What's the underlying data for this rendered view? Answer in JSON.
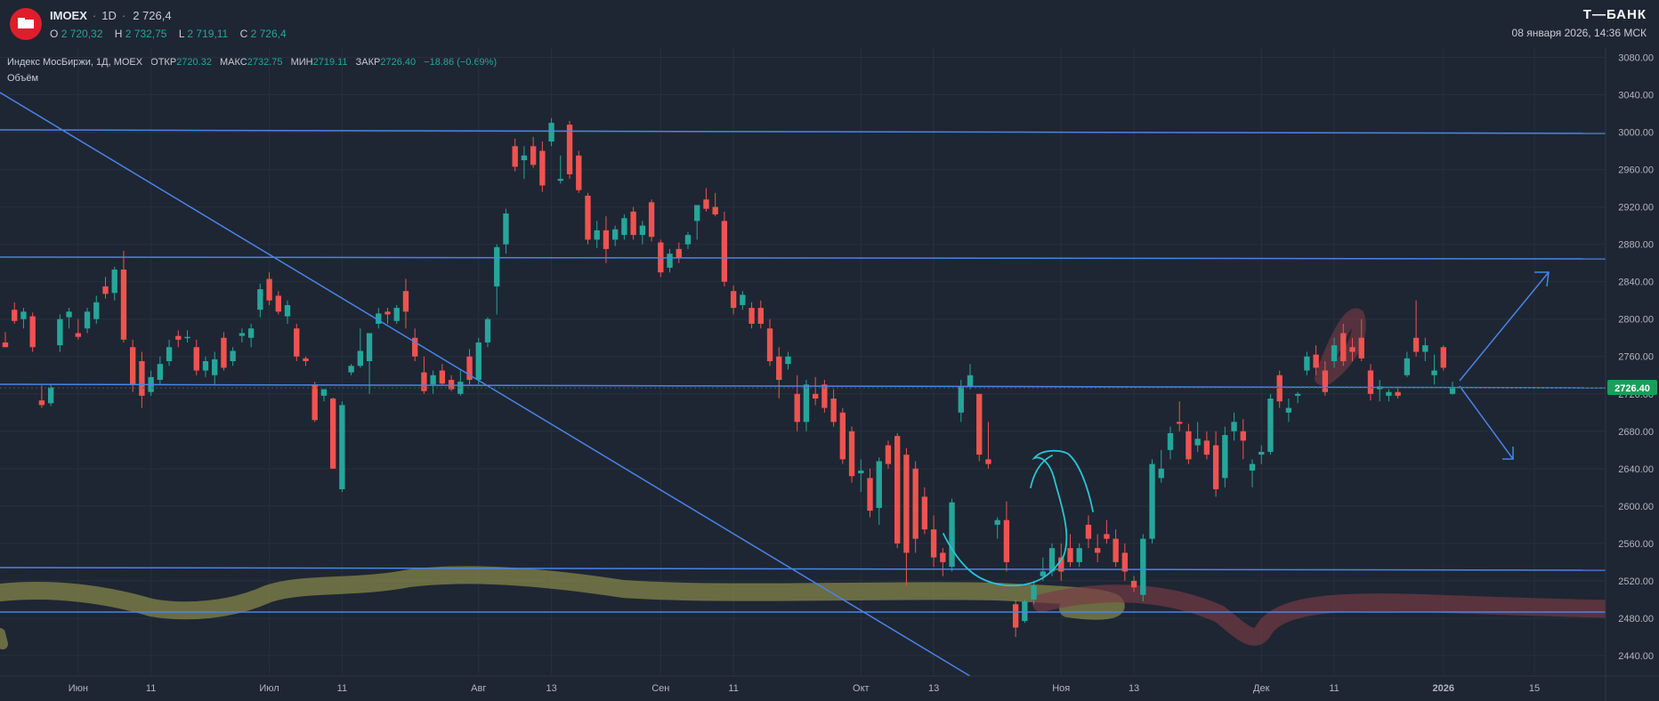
{
  "header": {
    "symbol": "IMOEX",
    "timeframe": "1D",
    "price": "2 726,4",
    "ohlc": [
      {
        "label": "O",
        "value": "2 720,32"
      },
      {
        "label": "H",
        "value": "2 732,75"
      },
      {
        "label": "L",
        "value": "2 719,11"
      },
      {
        "label": "C",
        "value": "2 726,4"
      }
    ],
    "brand": "Т—БАНК",
    "datetime": "08 января 2026, 14:36 МСК"
  },
  "legend": {
    "name": "Индекс МосБиржи, 1Д, MOEX",
    "items": [
      {
        "label": "ОТКР",
        "value": "2720.32"
      },
      {
        "label": "МАКС",
        "value": "2732.75"
      },
      {
        "label": "МИН",
        "value": "2719.11"
      },
      {
        "label": "ЗАКР",
        "value": "2726.40"
      }
    ],
    "change": "−18.86 (−0.69%)",
    "volume_label": "Объём"
  },
  "colors": {
    "background": "#1e2633",
    "up": "#26a69a",
    "down": "#ef5350",
    "drawing_line": "#4a84e8",
    "marker_yellow": "#8a8a4a",
    "marker_red": "#7a3a45",
    "pen_cyan": "#2bc4d4",
    "price_badge": "#1a9e5a"
  },
  "chart_data": {
    "type": "candlestick",
    "title": "Индекс МосБиржи, 1Д, MOEX",
    "ylim": [
      2420,
      3090
    ],
    "y_ticks": [
      "3080.00",
      "3040.00",
      "3000.00",
      "2960.00",
      "2920.00",
      "2880.00",
      "2840.00",
      "2800.00",
      "2760.00",
      "2720.00",
      "2680.00",
      "2640.00",
      "2600.00",
      "2560.00",
      "2520.00",
      "2480.00",
      "2440.00"
    ],
    "x_ticks": [
      "Июн",
      "11",
      "Июл",
      "11",
      "Авг",
      "13",
      "Сен",
      "11",
      "Окт",
      "13",
      "Ноя",
      "13",
      "Дек",
      "11",
      "2026",
      "15"
    ],
    "last_price_label": "2726.40",
    "last_price": 2726.4,
    "grid": true,
    "candles": [
      {
        "i": 0,
        "o": 2775,
        "h": 2786,
        "l": 2770,
        "c": 2770
      },
      {
        "i": 1,
        "o": 2810,
        "h": 2818,
        "l": 2795,
        "c": 2798
      },
      {
        "i": 2,
        "o": 2800,
        "h": 2812,
        "l": 2790,
        "c": 2808
      },
      {
        "i": 3,
        "o": 2803,
        "h": 2807,
        "l": 2765,
        "c": 2770
      },
      {
        "i": 4,
        "o": 2713,
        "h": 2729,
        "l": 2705,
        "c": 2708
      },
      {
        "i": 5,
        "o": 2710,
        "h": 2730,
        "l": 2707,
        "c": 2727
      },
      {
        "i": 6,
        "o": 2772,
        "h": 2805,
        "l": 2765,
        "c": 2800
      },
      {
        "i": 7,
        "o": 2802,
        "h": 2812,
        "l": 2790,
        "c": 2808
      },
      {
        "i": 8,
        "o": 2785,
        "h": 2800,
        "l": 2778,
        "c": 2781
      },
      {
        "i": 9,
        "o": 2790,
        "h": 2812,
        "l": 2785,
        "c": 2808
      },
      {
        "i": 10,
        "o": 2800,
        "h": 2825,
        "l": 2795,
        "c": 2818
      },
      {
        "i": 11,
        "o": 2835,
        "h": 2845,
        "l": 2822,
        "c": 2827
      },
      {
        "i": 12,
        "o": 2828,
        "h": 2856,
        "l": 2820,
        "c": 2853
      },
      {
        "i": 13,
        "o": 2853,
        "h": 2873,
        "l": 2775,
        "c": 2778
      },
      {
        "i": 14,
        "o": 2770,
        "h": 2778,
        "l": 2722,
        "c": 2730
      },
      {
        "i": 15,
        "o": 2755,
        "h": 2765,
        "l": 2705,
        "c": 2718
      },
      {
        "i": 16,
        "o": 2722,
        "h": 2745,
        "l": 2718,
        "c": 2738
      },
      {
        "i": 17,
        "o": 2735,
        "h": 2760,
        "l": 2730,
        "c": 2752
      },
      {
        "i": 18,
        "o": 2755,
        "h": 2778,
        "l": 2750,
        "c": 2770
      },
      {
        "i": 19,
        "o": 2782,
        "h": 2788,
        "l": 2770,
        "c": 2778
      },
      {
        "i": 20,
        "o": 2780,
        "h": 2788,
        "l": 2775,
        "c": 2781
      },
      {
        "i": 21,
        "o": 2770,
        "h": 2778,
        "l": 2740,
        "c": 2745
      },
      {
        "i": 22,
        "o": 2745,
        "h": 2760,
        "l": 2738,
        "c": 2755
      },
      {
        "i": 23,
        "o": 2740,
        "h": 2765,
        "l": 2730,
        "c": 2757
      },
      {
        "i": 24,
        "o": 2780,
        "h": 2786,
        "l": 2745,
        "c": 2748
      },
      {
        "i": 25,
        "o": 2755,
        "h": 2770,
        "l": 2750,
        "c": 2766
      },
      {
        "i": 26,
        "o": 2782,
        "h": 2790,
        "l": 2775,
        "c": 2785
      },
      {
        "i": 27,
        "o": 2780,
        "h": 2795,
        "l": 2770,
        "c": 2790
      },
      {
        "i": 28,
        "o": 2810,
        "h": 2838,
        "l": 2802,
        "c": 2832
      },
      {
        "i": 29,
        "o": 2843,
        "h": 2850,
        "l": 2815,
        "c": 2820
      },
      {
        "i": 30,
        "o": 2825,
        "h": 2830,
        "l": 2805,
        "c": 2808
      },
      {
        "i": 31,
        "o": 2803,
        "h": 2820,
        "l": 2795,
        "c": 2815
      },
      {
        "i": 32,
        "o": 2790,
        "h": 2795,
        "l": 2755,
        "c": 2760
      },
      {
        "i": 33,
        "o": 2758,
        "h": 2760,
        "l": 2750,
        "c": 2755
      },
      {
        "i": 34,
        "o": 2730,
        "h": 2733,
        "l": 2690,
        "c": 2692
      },
      {
        "i": 35,
        "o": 2718,
        "h": 2725,
        "l": 2712,
        "c": 2725
      },
      {
        "i": 36,
        "o": 2715,
        "h": 2716,
        "l": 2640,
        "c": 2640
      },
      {
        "i": 37,
        "o": 2618,
        "h": 2712,
        "l": 2615,
        "c": 2708
      },
      {
        "i": 38,
        "o": 2743,
        "h": 2752,
        "l": 2740,
        "c": 2750
      },
      {
        "i": 39,
        "o": 2750,
        "h": 2790,
        "l": 2748,
        "c": 2766
      },
      {
        "i": 40,
        "o": 2755,
        "h": 2780,
        "l": 2720,
        "c": 2785
      },
      {
        "i": 41,
        "o": 2795,
        "h": 2812,
        "l": 2790,
        "c": 2806
      },
      {
        "i": 42,
        "o": 2808,
        "h": 2812,
        "l": 2795,
        "c": 2805
      },
      {
        "i": 43,
        "o": 2798,
        "h": 2815,
        "l": 2795,
        "c": 2812
      },
      {
        "i": 44,
        "o": 2830,
        "h": 2843,
        "l": 2790,
        "c": 2808
      },
      {
        "i": 45,
        "o": 2780,
        "h": 2790,
        "l": 2755,
        "c": 2760
      },
      {
        "i": 46,
        "o": 2743,
        "h": 2760,
        "l": 2720,
        "c": 2723
      },
      {
        "i": 47,
        "o": 2730,
        "h": 2745,
        "l": 2720,
        "c": 2740
      },
      {
        "i": 48,
        "o": 2745,
        "h": 2752,
        "l": 2730,
        "c": 2731
      },
      {
        "i": 49,
        "o": 2735,
        "h": 2740,
        "l": 2723,
        "c": 2725
      },
      {
        "i": 50,
        "o": 2720,
        "h": 2745,
        "l": 2718,
        "c": 2733
      },
      {
        "i": 51,
        "o": 2760,
        "h": 2768,
        "l": 2730,
        "c": 2735
      },
      {
        "i": 52,
        "o": 2735,
        "h": 2780,
        "l": 2730,
        "c": 2775
      },
      {
        "i": 53,
        "o": 2775,
        "h": 2802,
        "l": 2770,
        "c": 2800
      },
      {
        "i": 54,
        "o": 2835,
        "h": 2880,
        "l": 2805,
        "c": 2877
      },
      {
        "i": 55,
        "o": 2880,
        "h": 2918,
        "l": 2870,
        "c": 2913
      },
      {
        "i": 56,
        "o": 2985,
        "h": 2993,
        "l": 2958,
        "c": 2963
      },
      {
        "i": 57,
        "o": 2970,
        "h": 2985,
        "l": 2950,
        "c": 2975
      },
      {
        "i": 58,
        "o": 2985,
        "h": 2995,
        "l": 2962,
        "c": 2965
      },
      {
        "i": 59,
        "o": 2980,
        "h": 2990,
        "l": 2936,
        "c": 2943
      },
      {
        "i": 60,
        "o": 2990,
        "h": 3015,
        "l": 2985,
        "c": 3010
      },
      {
        "i": 61,
        "o": 2948,
        "h": 2975,
        "l": 2945,
        "c": 2950
      },
      {
        "i": 62,
        "o": 3008,
        "h": 3012,
        "l": 2950,
        "c": 2955
      },
      {
        "i": 63,
        "o": 2975,
        "h": 2980,
        "l": 2935,
        "c": 2938
      },
      {
        "i": 64,
        "o": 2932,
        "h": 2935,
        "l": 2880,
        "c": 2885
      },
      {
        "i": 65,
        "o": 2885,
        "h": 2905,
        "l": 2876,
        "c": 2895
      },
      {
        "i": 66,
        "o": 2895,
        "h": 2910,
        "l": 2860,
        "c": 2875
      },
      {
        "i": 67,
        "o": 2885,
        "h": 2900,
        "l": 2878,
        "c": 2896
      },
      {
        "i": 68,
        "o": 2890,
        "h": 2912,
        "l": 2885,
        "c": 2908
      },
      {
        "i": 69,
        "o": 2915,
        "h": 2920,
        "l": 2885,
        "c": 2890
      },
      {
        "i": 70,
        "o": 2890,
        "h": 2905,
        "l": 2880,
        "c": 2900
      },
      {
        "i": 71,
        "o": 2925,
        "h": 2928,
        "l": 2883,
        "c": 2888
      },
      {
        "i": 72,
        "o": 2882,
        "h": 2885,
        "l": 2845,
        "c": 2850
      },
      {
        "i": 73,
        "o": 2855,
        "h": 2875,
        "l": 2850,
        "c": 2870
      },
      {
        "i": 74,
        "o": 2875,
        "h": 2882,
        "l": 2860,
        "c": 2865
      },
      {
        "i": 75,
        "o": 2880,
        "h": 2893,
        "l": 2875,
        "c": 2890
      },
      {
        "i": 76,
        "o": 2905,
        "h": 2915,
        "l": 2885,
        "c": 2922
      },
      {
        "i": 77,
        "o": 2928,
        "h": 2940,
        "l": 2915,
        "c": 2918
      },
      {
        "i": 78,
        "o": 2920,
        "h": 2935,
        "l": 2910,
        "c": 2912
      },
      {
        "i": 79,
        "o": 2905,
        "h": 2915,
        "l": 2835,
        "c": 2840
      },
      {
        "i": 80,
        "o": 2830,
        "h": 2836,
        "l": 2805,
        "c": 2812
      },
      {
        "i": 81,
        "o": 2815,
        "h": 2830,
        "l": 2810,
        "c": 2826
      },
      {
        "i": 82,
        "o": 2812,
        "h": 2818,
        "l": 2790,
        "c": 2795
      },
      {
        "i": 83,
        "o": 2812,
        "h": 2820,
        "l": 2790,
        "c": 2795
      },
      {
        "i": 84,
        "o": 2790,
        "h": 2800,
        "l": 2750,
        "c": 2755
      },
      {
        "i": 85,
        "o": 2760,
        "h": 2770,
        "l": 2715,
        "c": 2735
      },
      {
        "i": 86,
        "o": 2752,
        "h": 2765,
        "l": 2746,
        "c": 2760
      },
      {
        "i": 87,
        "o": 2720,
        "h": 2740,
        "l": 2680,
        "c": 2690
      },
      {
        "i": 88,
        "o": 2690,
        "h": 2735,
        "l": 2680,
        "c": 2730
      },
      {
        "i": 89,
        "o": 2720,
        "h": 2738,
        "l": 2708,
        "c": 2715
      },
      {
        "i": 90,
        "o": 2730,
        "h": 2735,
        "l": 2700,
        "c": 2705
      },
      {
        "i": 91,
        "o": 2715,
        "h": 2725,
        "l": 2685,
        "c": 2690
      },
      {
        "i": 92,
        "o": 2700,
        "h": 2705,
        "l": 2645,
        "c": 2650
      },
      {
        "i": 93,
        "o": 2680,
        "h": 2685,
        "l": 2625,
        "c": 2632
      },
      {
        "i": 94,
        "o": 2635,
        "h": 2650,
        "l": 2615,
        "c": 2638
      },
      {
        "i": 95,
        "o": 2630,
        "h": 2640,
        "l": 2588,
        "c": 2595
      },
      {
        "i": 96,
        "o": 2598,
        "h": 2652,
        "l": 2580,
        "c": 2648
      },
      {
        "i": 97,
        "o": 2665,
        "h": 2670,
        "l": 2640,
        "c": 2645
      },
      {
        "i": 98,
        "o": 2675,
        "h": 2678,
        "l": 2555,
        "c": 2560
      },
      {
        "i": 99,
        "o": 2655,
        "h": 2662,
        "l": 2515,
        "c": 2550
      },
      {
        "i": 100,
        "o": 2640,
        "h": 2648,
        "l": 2550,
        "c": 2565
      },
      {
        "i": 101,
        "o": 2610,
        "h": 2620,
        "l": 2570,
        "c": 2575
      },
      {
        "i": 102,
        "o": 2575,
        "h": 2590,
        "l": 2535,
        "c": 2545
      },
      {
        "i": 103,
        "o": 2550,
        "h": 2555,
        "l": 2525,
        "c": 2540
      },
      {
        "i": 104,
        "o": 2535,
        "h": 2608,
        "l": 2530,
        "c": 2604
      },
      {
        "i": 105,
        "o": 2700,
        "h": 2735,
        "l": 2690,
        "c": 2728
      },
      {
        "i": 106,
        "o": 2728,
        "h": 2752,
        "l": 2725,
        "c": 2740
      },
      {
        "i": 107,
        "o": 2720,
        "h": 2705,
        "l": 2648,
        "c": 2655
      },
      {
        "i": 108,
        "o": 2650,
        "h": 2690,
        "l": 2640,
        "c": 2645
      },
      {
        "i": 109,
        "o": 2580,
        "h": 2588,
        "l": 2565,
        "c": 2585
      },
      {
        "i": 110,
        "o": 2585,
        "h": 2605,
        "l": 2530,
        "c": 2540
      },
      {
        "i": 111,
        "o": 2495,
        "h": 2500,
        "l": 2460,
        "c": 2470
      },
      {
        "i": 112,
        "o": 2477,
        "h": 2500,
        "l": 2475,
        "c": 2498
      },
      {
        "i": 113,
        "o": 2500,
        "h": 2520,
        "l": 2495,
        "c": 2515
      },
      {
        "i": 114,
        "o": 2525,
        "h": 2545,
        "l": 2520,
        "c": 2530
      },
      {
        "i": 115,
        "o": 2530,
        "h": 2560,
        "l": 2525,
        "c": 2555
      },
      {
        "i": 116,
        "o": 2545,
        "h": 2560,
        "l": 2520,
        "c": 2530
      },
      {
        "i": 117,
        "o": 2555,
        "h": 2570,
        "l": 2535,
        "c": 2540
      },
      {
        "i": 118,
        "o": 2540,
        "h": 2560,
        "l": 2535,
        "c": 2555
      },
      {
        "i": 119,
        "o": 2580,
        "h": 2590,
        "l": 2555,
        "c": 2565
      },
      {
        "i": 120,
        "o": 2555,
        "h": 2570,
        "l": 2540,
        "c": 2550
      },
      {
        "i": 121,
        "o": 2570,
        "h": 2585,
        "l": 2560,
        "c": 2565
      },
      {
        "i": 122,
        "o": 2565,
        "h": 2575,
        "l": 2535,
        "c": 2540
      },
      {
        "i": 123,
        "o": 2550,
        "h": 2560,
        "l": 2520,
        "c": 2530
      },
      {
        "i": 124,
        "o": 2520,
        "h": 2525,
        "l": 2508,
        "c": 2513
      },
      {
        "i": 125,
        "o": 2505,
        "h": 2570,
        "l": 2498,
        "c": 2565
      },
      {
        "i": 126,
        "o": 2565,
        "h": 2650,
        "l": 2560,
        "c": 2645
      },
      {
        "i": 127,
        "o": 2630,
        "h": 2660,
        "l": 2625,
        "c": 2640
      },
      {
        "i": 128,
        "o": 2660,
        "h": 2685,
        "l": 2650,
        "c": 2678
      },
      {
        "i": 129,
        "o": 2690,
        "h": 2712,
        "l": 2680,
        "c": 2688
      },
      {
        "i": 130,
        "o": 2680,
        "h": 2688,
        "l": 2645,
        "c": 2650
      },
      {
        "i": 131,
        "o": 2665,
        "h": 2690,
        "l": 2658,
        "c": 2672
      },
      {
        "i": 132,
        "o": 2670,
        "h": 2680,
        "l": 2650,
        "c": 2655
      },
      {
        "i": 133,
        "o": 2665,
        "h": 2680,
        "l": 2610,
        "c": 2618
      },
      {
        "i": 134,
        "o": 2630,
        "h": 2685,
        "l": 2620,
        "c": 2676
      },
      {
        "i": 135,
        "o": 2680,
        "h": 2700,
        "l": 2670,
        "c": 2690
      },
      {
        "i": 136,
        "o": 2680,
        "h": 2693,
        "l": 2650,
        "c": 2670
      },
      {
        "i": 137,
        "o": 2638,
        "h": 2650,
        "l": 2620,
        "c": 2645
      },
      {
        "i": 138,
        "o": 2655,
        "h": 2665,
        "l": 2645,
        "c": 2658
      },
      {
        "i": 139,
        "o": 2658,
        "h": 2720,
        "l": 2655,
        "c": 2715
      },
      {
        "i": 140,
        "o": 2740,
        "h": 2745,
        "l": 2705,
        "c": 2712
      },
      {
        "i": 141,
        "o": 2700,
        "h": 2715,
        "l": 2690,
        "c": 2705
      },
      {
        "i": 142,
        "o": 2718,
        "h": 2722,
        "l": 2710,
        "c": 2720
      },
      {
        "i": 143,
        "o": 2745,
        "h": 2765,
        "l": 2740,
        "c": 2760
      },
      {
        "i": 144,
        "o": 2762,
        "h": 2772,
        "l": 2740,
        "c": 2748
      },
      {
        "i": 145,
        "o": 2745,
        "h": 2755,
        "l": 2718,
        "c": 2722
      },
      {
        "i": 146,
        "o": 2755,
        "h": 2780,
        "l": 2748,
        "c": 2772
      },
      {
        "i": 147,
        "o": 2785,
        "h": 2795,
        "l": 2750,
        "c": 2755
      },
      {
        "i": 148,
        "o": 2770,
        "h": 2780,
        "l": 2755,
        "c": 2765
      },
      {
        "i": 149,
        "o": 2780,
        "h": 2800,
        "l": 2755,
        "c": 2758
      },
      {
        "i": 150,
        "o": 2745,
        "h": 2752,
        "l": 2713,
        "c": 2720
      },
      {
        "i": 151,
        "o": 2725,
        "h": 2735,
        "l": 2712,
        "c": 2728
      },
      {
        "i": 152,
        "o": 2718,
        "h": 2725,
        "l": 2712,
        "c": 2722
      },
      {
        "i": 153,
        "o": 2722,
        "h": 2728,
        "l": 2715,
        "c": 2718
      },
      {
        "i": 154,
        "o": 2740,
        "h": 2765,
        "l": 2738,
        "c": 2758
      },
      {
        "i": 155,
        "o": 2780,
        "h": 2820,
        "l": 2760,
        "c": 2765
      },
      {
        "i": 156,
        "o": 2765,
        "h": 2780,
        "l": 2755,
        "c": 2772
      },
      {
        "i": 157,
        "o": 2740,
        "h": 2762,
        "l": 2730,
        "c": 2745
      },
      {
        "i": 158,
        "o": 2770,
        "h": 2772,
        "l": 2745,
        "c": 2748
      },
      {
        "i": 159,
        "o": 2720,
        "h": 2733,
        "l": 2719,
        "c": 2726
      }
    ]
  }
}
